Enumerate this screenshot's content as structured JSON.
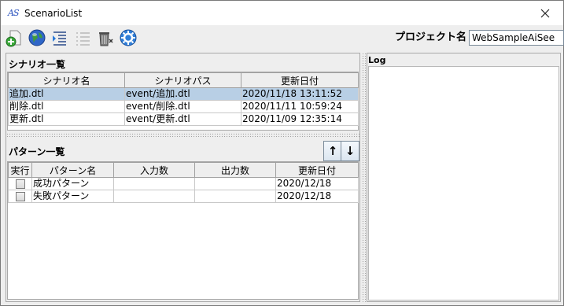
{
  "window": {
    "title": "ScenarioList",
    "icon_text": "AS"
  },
  "toolbar": {
    "buttons": [
      {
        "name": "new-scenario-icon"
      },
      {
        "name": "globe-icon"
      },
      {
        "name": "indent-icon"
      },
      {
        "name": "list-icon"
      },
      {
        "name": "trash-icon"
      },
      {
        "name": "settings-icon"
      }
    ],
    "project_label": "プロジェクト名",
    "project_value": "WebSampleAiSee"
  },
  "scenario": {
    "title": "シナリオ一覧",
    "columns": [
      "シナリオ名",
      "シナリオパス",
      "更新日付"
    ],
    "rows": [
      {
        "name": "追加.dtl",
        "path": "event/追加.dtl",
        "date": "2020/11/18 13:11:52",
        "selected": true
      },
      {
        "name": "削除.dtl",
        "path": "event/削除.dtl",
        "date": "2020/11/11 10:59:24",
        "selected": false
      },
      {
        "name": "更新.dtl",
        "path": "event/更新.dtl",
        "date": "2020/11/09 12:35:14",
        "selected": false
      }
    ]
  },
  "pattern": {
    "title": "パターン一覧",
    "up_label": "↑",
    "down_label": "↓",
    "columns": [
      "実行",
      "パターン名",
      "入力数",
      "出力数",
      "更新日付"
    ],
    "rows": [
      {
        "checked": false,
        "name": "成功パターン",
        "inputs": "",
        "outputs": "",
        "date": "2020/12/18"
      },
      {
        "checked": false,
        "name": "失敗パターン",
        "inputs": "",
        "outputs": "",
        "date": "2020/12/18"
      }
    ]
  },
  "log": {
    "title": "Log",
    "content": ""
  },
  "colors": {
    "selection": "#b8cfe5",
    "background": "#eeeeee"
  }
}
